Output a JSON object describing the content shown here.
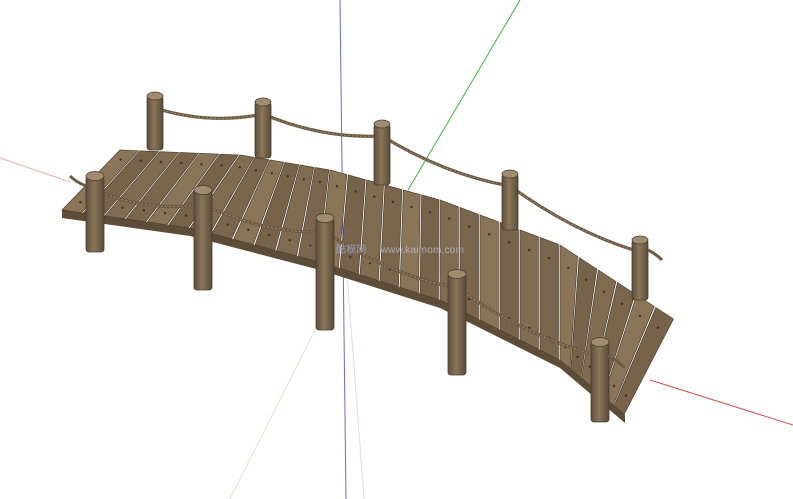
{
  "scene": {
    "subject": "wooden-footbridge-3d-model",
    "background": "#ffffff",
    "colors": {
      "plank_light": "#8a7558",
      "plank_mid": "#76634a",
      "plank_dark": "#5c4c38",
      "post": "#7c6a52",
      "post_top": "#a08c70",
      "rope": "#6b5a44",
      "axis_red": "#d04848",
      "axis_green": "#3aa83a",
      "axis_blue": "#5a5ad0"
    }
  },
  "watermark": {
    "logo_text": "酷模网",
    "url_text": "www.kaimom.com"
  }
}
